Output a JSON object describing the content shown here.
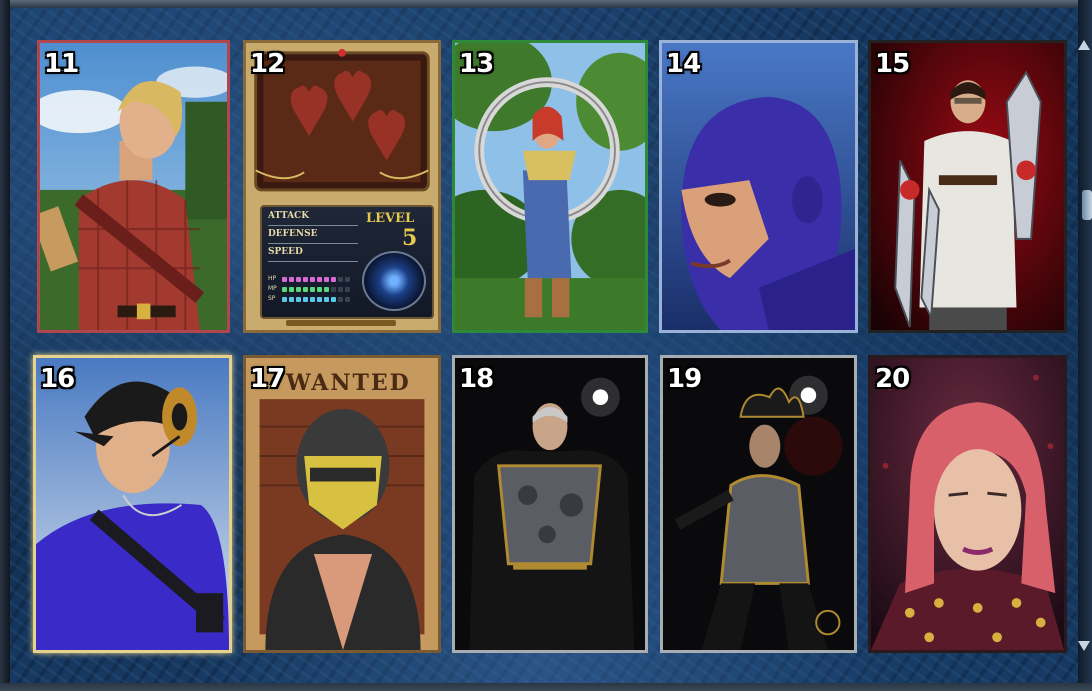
{
  "screen": "character select",
  "cards": [
    {
      "number": "11",
      "name": "lumberjack-portrait"
    },
    {
      "number": "12",
      "name": "stat-card",
      "stats": {
        "attack_label": "ATTACK",
        "defense_label": "DEFENSE",
        "speed_label": "SPEED",
        "level_label": "LEVEL",
        "level_value": "5",
        "pips": [
          {
            "label": "HP",
            "filled": 8,
            "color": "#d86ad8"
          },
          {
            "label": "MP",
            "filled": 7,
            "color": "#5ad87a"
          },
          {
            "label": "SP",
            "filled": 8,
            "color": "#5ac8e8"
          }
        ]
      }
    },
    {
      "number": "13",
      "name": "farmer-girl-portrait"
    },
    {
      "number": "14",
      "name": "masked-wrestler-portrait"
    },
    {
      "number": "15",
      "name": "scholar-with-blades-portrait"
    },
    {
      "number": "16",
      "name": "courier-portrait"
    },
    {
      "number": "17",
      "name": "wanted-poster-portrait",
      "poster_text": "WANTED"
    },
    {
      "number": "18",
      "name": "armored-knight-portrait"
    },
    {
      "number": "19",
      "name": "plumed-knight-portrait"
    },
    {
      "number": "20",
      "name": "red-haired-noble-portrait"
    }
  ],
  "selected_card": "16",
  "colors": {
    "background": "#163a63",
    "selected_border": "#e6d28a"
  }
}
